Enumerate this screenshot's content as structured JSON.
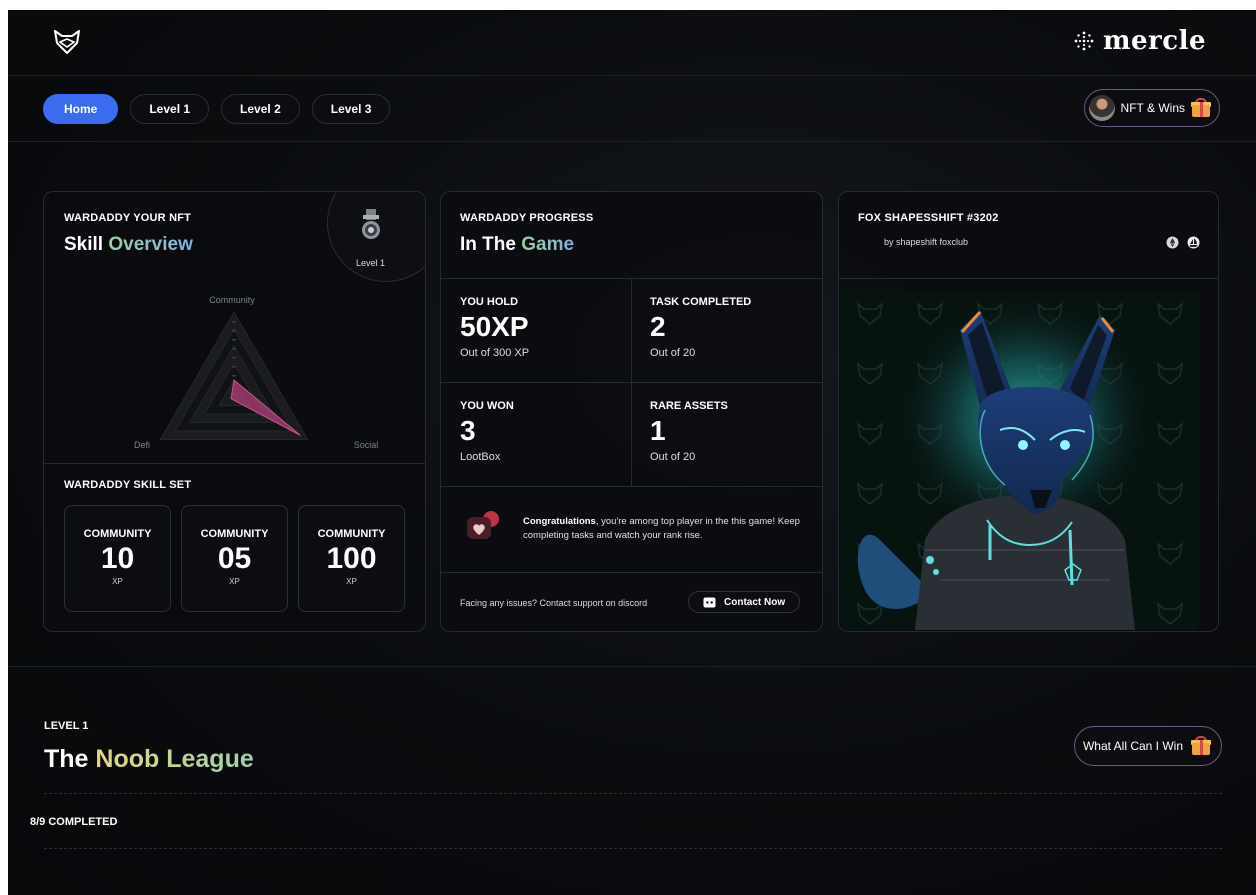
{
  "brand": {
    "name": "mercle"
  },
  "nav": {
    "tabs": [
      {
        "label": "Home"
      },
      {
        "label": "Level 1"
      },
      {
        "label": "Level 2"
      },
      {
        "label": "Level 3"
      }
    ],
    "nft_wins_label": "NFT & Wins"
  },
  "skill_card": {
    "eyebrow": "WARDADDY YOUR NFT",
    "title_plain": "Skill",
    "title_accent": "Overview",
    "level_label": "Level 1",
    "radar": {
      "axes": [
        "Community",
        "Social",
        "Defi"
      ],
      "values": [
        0.2,
        0.9,
        0.0
      ]
    },
    "skillset_title": "WARDADDY SKILL SET",
    "skills": [
      {
        "label": "COMMUNITY",
        "value": "10",
        "unit": "XP"
      },
      {
        "label": "COMMUNITY",
        "value": "05",
        "unit": "XP"
      },
      {
        "label": "COMMUNITY",
        "value": "100",
        "unit": "XP"
      }
    ]
  },
  "progress_card": {
    "eyebrow": "WARDADDY PROGRESS",
    "title_plain": "In The",
    "title_accent": "Game",
    "stats": [
      {
        "label": "YOU HOLD",
        "value": "50XP",
        "sub": "Out of 300 XP"
      },
      {
        "label": "TASK COMPLETED",
        "value": "2",
        "sub": "Out of 20"
      },
      {
        "label": "YOU WON",
        "value": "3",
        "sub": "LootBox"
      },
      {
        "label": "RARE ASSETS",
        "value": "1",
        "sub": "Out of 20"
      }
    ],
    "congrats_bold": "Congratulations",
    "congrats_text": ", you're among top player in the this game! Keep completing tasks and watch your rank rise.",
    "support_text": "Facing any issues? Contact support on discord",
    "contact_label": "Contact Now"
  },
  "nft_card": {
    "title": "FOX SHAPESSHIFT #3202",
    "by_line": "by shapeshift foxclub"
  },
  "level_section": {
    "eyebrow": "LEVEL 1",
    "title_plain": "The",
    "title_accent": "Noob League",
    "win_label": "What All Can I Win",
    "completed": "8/9 COMPLETED"
  },
  "colors": {
    "accent_blue": "#3b6cf0",
    "radar_fill": "#b0407a",
    "border_purple": "#6b5a86"
  }
}
